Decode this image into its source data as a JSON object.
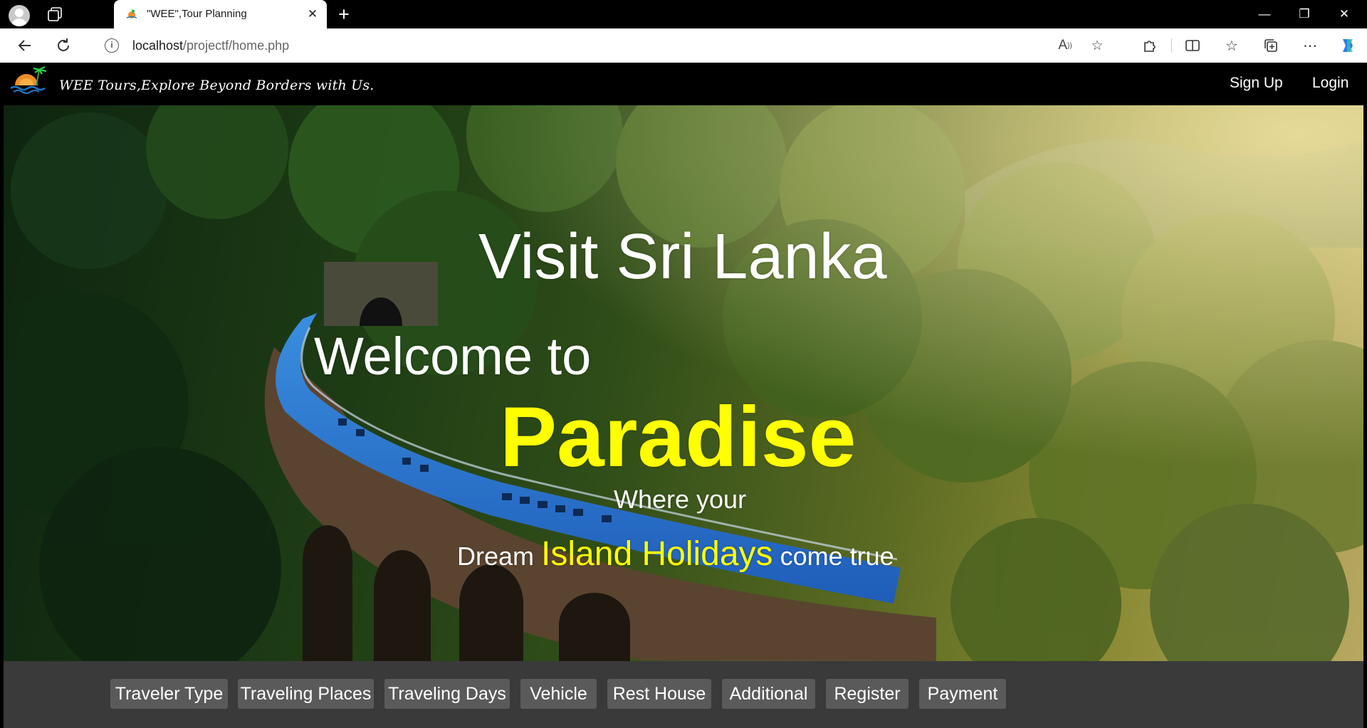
{
  "browser": {
    "tab_title": "\"WEE\",Tour Planning",
    "url_host": "localhost",
    "url_path": "/projectf/home.php"
  },
  "site": {
    "tagline": "WEE Tours,Explore Beyond Borders with Us.",
    "nav": {
      "signup": "Sign Up",
      "login": "Login"
    }
  },
  "hero": {
    "title": "Visit Sri Lanka",
    "welcome": "Welcome to",
    "paradise": "Paradise",
    "where": "Where your",
    "dream_pre": "Dream",
    "dream_highlight": "Island Holidays",
    "dream_post": "come true"
  },
  "menu": {
    "traveler_type": "Traveler Type",
    "traveling_places": "Traveling Places",
    "traveling_days": "Traveling Days",
    "vehicle": "Vehicle",
    "rest_house": "Rest House",
    "additional": "Additional",
    "register": "Register",
    "payment": "Payment"
  },
  "colors": {
    "highlight": "#ffff00",
    "header_bg": "#000000",
    "menu_bg": "#3a3a3a",
    "menu_button": "#5a5a5a"
  }
}
